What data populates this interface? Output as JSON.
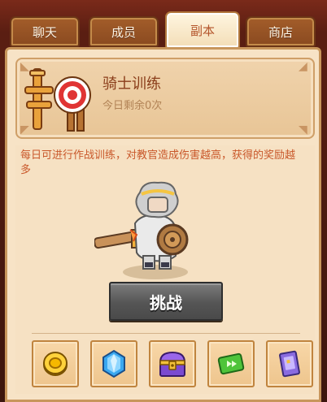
{
  "tabs": [
    {
      "label": "聊天",
      "active": false
    },
    {
      "label": "成员",
      "active": false
    },
    {
      "label": "副本",
      "active": true
    },
    {
      "label": "商店",
      "active": false
    }
  ],
  "dungeon": {
    "title": "骑士训练",
    "remaining": "今日剩余0次",
    "description": "每日可进行作战训练，对教官造成伤害越高，获得的奖励越多",
    "challenge_label": "挑战"
  },
  "rewards": [
    {
      "icon": "gold-coin-icon"
    },
    {
      "icon": "blue-gem-icon"
    },
    {
      "icon": "treasure-chest-icon"
    },
    {
      "icon": "green-ticket-icon"
    },
    {
      "icon": "purple-card-icon"
    }
  ],
  "colors": {
    "accent": "#b4552b",
    "button": "#555555",
    "panel": "#f7e3c6"
  }
}
